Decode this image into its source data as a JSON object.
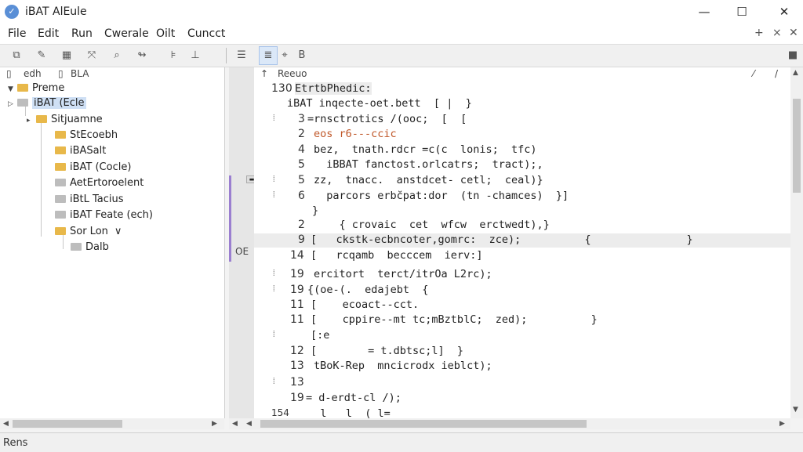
{
  "window": {
    "title": "iBAT AlEule",
    "minimize": "—",
    "maximize": "☐",
    "close": "✕"
  },
  "menu": [
    "File",
    "Edit",
    "Run",
    "Cwerale",
    "Oilt",
    "Cuncct"
  ],
  "menu_right": {
    "pin": "+",
    "close": "×"
  },
  "toolbar_icons": [
    "copy-icon",
    "brush-icon",
    "grid-icon",
    "expand-icon",
    "search-icon",
    "link-icon",
    "align-icon",
    "down-icon",
    "menu-icon",
    "list-icon",
    "chat-icon",
    "bold-icon",
    "close-icon"
  ],
  "tree": {
    "header": {
      "left": "edh",
      "right": "BLA"
    },
    "nodes": [
      {
        "label": "Preme",
        "level": 0
      },
      {
        "label": "iBAT (Ecle",
        "level": 0
      },
      {
        "label": "Sitjuamne",
        "level": 1
      },
      {
        "label": "StEcoebh",
        "level": 2
      },
      {
        "label": "iBASalt",
        "level": 2
      },
      {
        "label": "iBAT (Cocle)",
        "level": 2
      },
      {
        "label": "AetErtoroelent",
        "level": 2
      },
      {
        "label": "iBtL Tacius",
        "level": 2
      },
      {
        "label": "iBAT Feate (ech)",
        "level": 2
      },
      {
        "label": "Sor Lon",
        "level": 2
      },
      {
        "label": "Dalb",
        "level": 3
      }
    ]
  },
  "editor": {
    "header": "Reeuo",
    "header_icons": {
      "left": "↑",
      "right1": "⁄",
      "right2": "/"
    },
    "gutter_badge": "OE",
    "gutter_box": "▬",
    "lines": [
      {
        "ln": "130",
        "code": "EtrtbPhedic:"
      },
      {
        "ln": "",
        "code": "iBAT inqecte-oet.bett  [ |  }"
      },
      {
        "ln": "3",
        "code": "=rnsctrotics /(ooc;  [  ["
      },
      {
        "ln": "2",
        "code": "eos r6---ccic"
      },
      {
        "ln": "4",
        "code": "bez,  tnath.rdcr =c(c  lonis;  tfc)"
      },
      {
        "ln": "5",
        "code": "  iBBAT fanctost.orlcatrs;  tract);,"
      },
      {
        "ln": "5",
        "code": "zz,  tnacc.  anstdcet- cetl;  ceal)}"
      },
      {
        "ln": "6",
        "code": "  parcors erbc̆pat:dor  (tn -chamces)  }]"
      },
      {
        "ln": "",
        "code": "}"
      },
      {
        "ln": "2",
        "code": "    { crovaic  cet  wfcw  erctwedt),}"
      },
      {
        "ln": "9",
        "code": "[   ckstk-ecbncoter,gomrc:  zce);          {               }"
      },
      {
        "ln": "14",
        "code": "[   rcqamb  becccem  ierv:]"
      },
      {
        "ln": "19",
        "code": "ercitort  terct/itrOa L2rc);"
      },
      {
        "ln": "19",
        "code": "{(oe-(.  edajebt  {"
      },
      {
        "ln": "11",
        "code": "[    ecoact--cct."
      },
      {
        "ln": "11",
        "code": "[    cppire--mt tc;mBztblC;  zed);          }"
      },
      {
        "ln": "",
        "code": "[:e"
      },
      {
        "ln": "12",
        "code": "[        = t.dbtsc;l]  }"
      },
      {
        "ln": "13",
        "code": "tBoK-Rep  mncicrodx ieblct);"
      },
      {
        "ln": "13",
        "code": ""
      },
      {
        "ln": "19",
        "code": "= d-erdt-cl /);"
      },
      {
        "ln": "154",
        "code": "   l   l  ( l=   "
      }
    ]
  },
  "status": "Rens",
  "colors": {
    "accent": "#9b7fd0",
    "folder": "#e8b84a",
    "selection": "#cfe0f5"
  }
}
